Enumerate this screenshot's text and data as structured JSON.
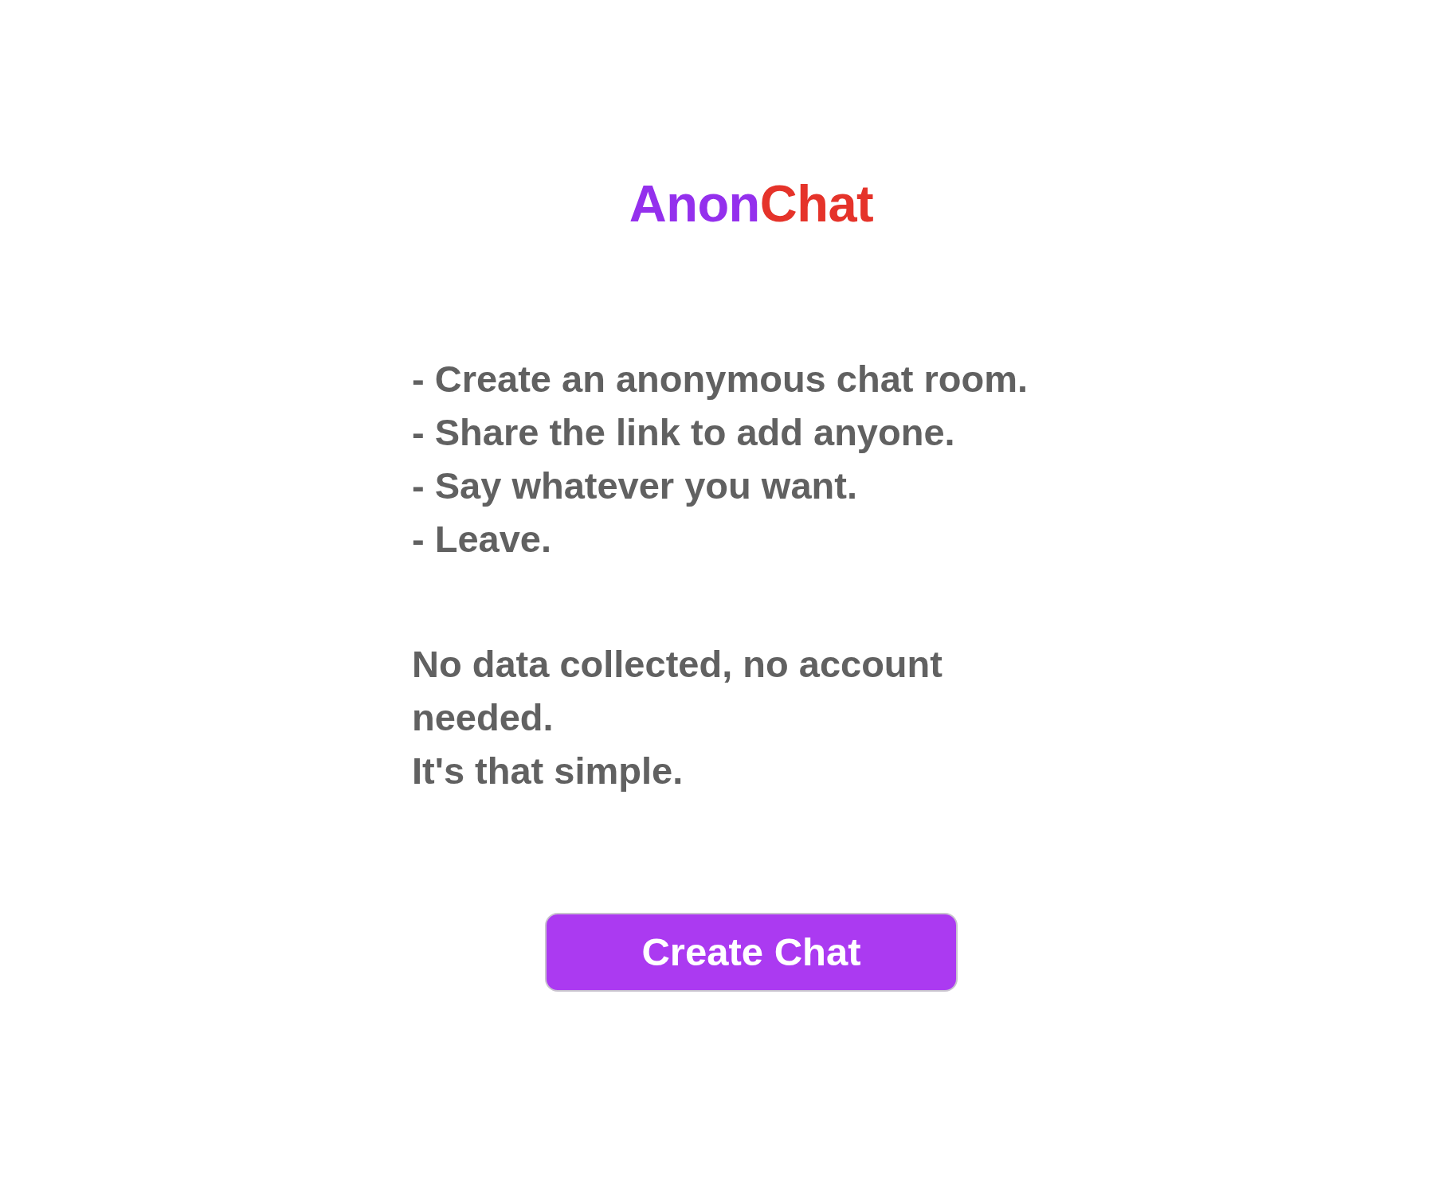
{
  "title": {
    "parts": [
      {
        "text": "Anon",
        "color": "#9430ed"
      },
      {
        "text": "Chat",
        "color": "#e5332a"
      }
    ]
  },
  "features": [
    "- Create an anonymous chat room.",
    "- Share the link to add anyone.",
    "- Say whatever you want.",
    "- Leave."
  ],
  "notes": [
    "No data collected, no account needed.",
    "It's that simple."
  ],
  "button": {
    "label": "Create Chat"
  }
}
